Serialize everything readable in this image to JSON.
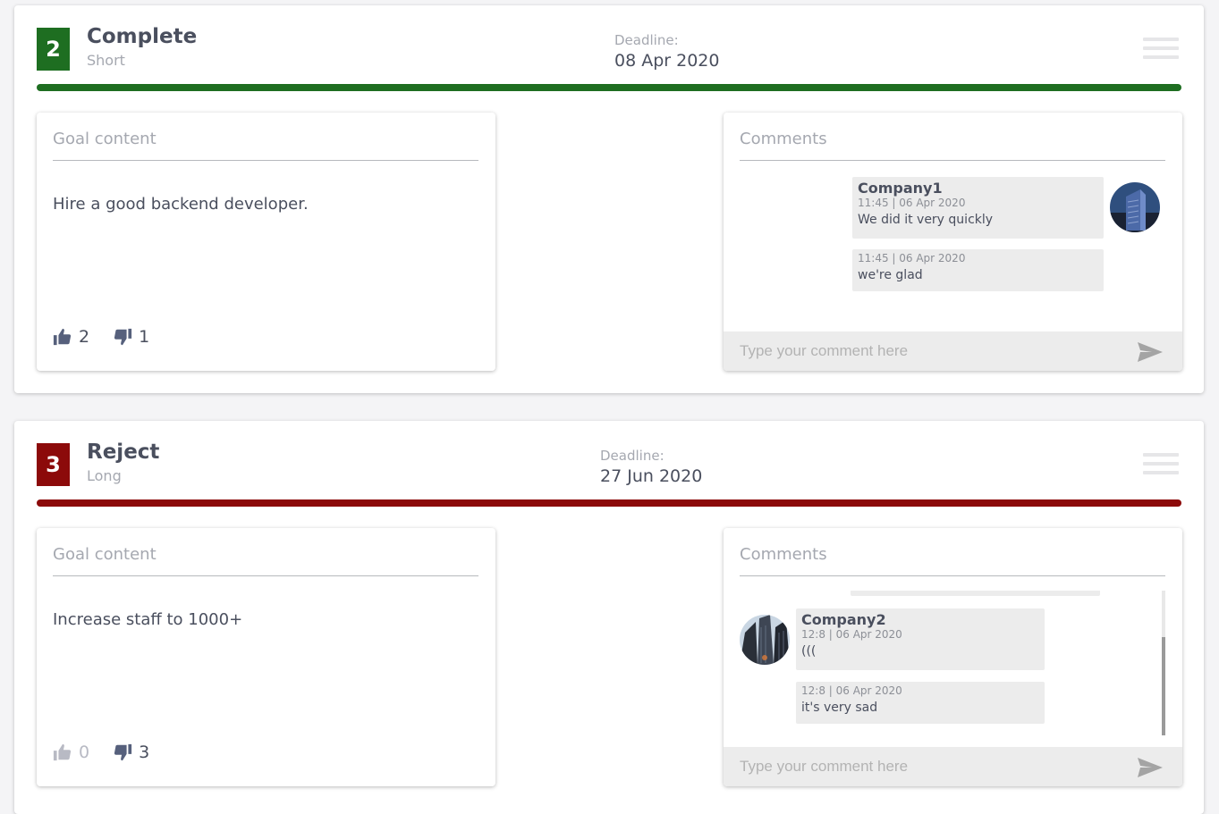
{
  "goals": [
    {
      "number": "2",
      "status": "Complete",
      "term": "Short",
      "status_color": "#1e6e21",
      "deadline_label": "Deadline:",
      "deadline": "08 Apr 2020",
      "content_title": "Goal content",
      "content_text": "Hire a good backend developer.",
      "likes": "2",
      "dislikes": "1",
      "comments_title": "Comments",
      "comments": [
        {
          "author": "Company1",
          "time": "11:45 | 06 Apr 2020",
          "text": "We did it very quickly"
        },
        {
          "author": "",
          "time": "11:45 | 06 Apr 2020",
          "text": "we're glad"
        }
      ],
      "comment_placeholder": "Type your comment here"
    },
    {
      "number": "3",
      "status": "Reject",
      "term": "Long",
      "status_color": "#8c0a0a",
      "deadline_label": "Deadline:",
      "deadline": "27 Jun 2020",
      "content_title": "Goal content",
      "content_text": "Increase staff to 1000+",
      "likes": "0",
      "dislikes": "3",
      "comments_title": "Comments",
      "comments": [
        {
          "author": "Company2",
          "time": "12:8 | 06 Apr 2020",
          "text": "((("
        },
        {
          "author": "",
          "time": "12:8 | 06 Apr 2020",
          "text": "it's very sad"
        }
      ],
      "comment_placeholder": "Type your comment here"
    }
  ],
  "icons": {
    "like": "thumbs-up-icon",
    "dislike": "thumbs-down-icon",
    "send": "send-icon",
    "menu": "hamburger-menu-icon"
  },
  "colors": {
    "vote_icon": "#56607c",
    "vote_icon_dim": "#b8bac4"
  }
}
